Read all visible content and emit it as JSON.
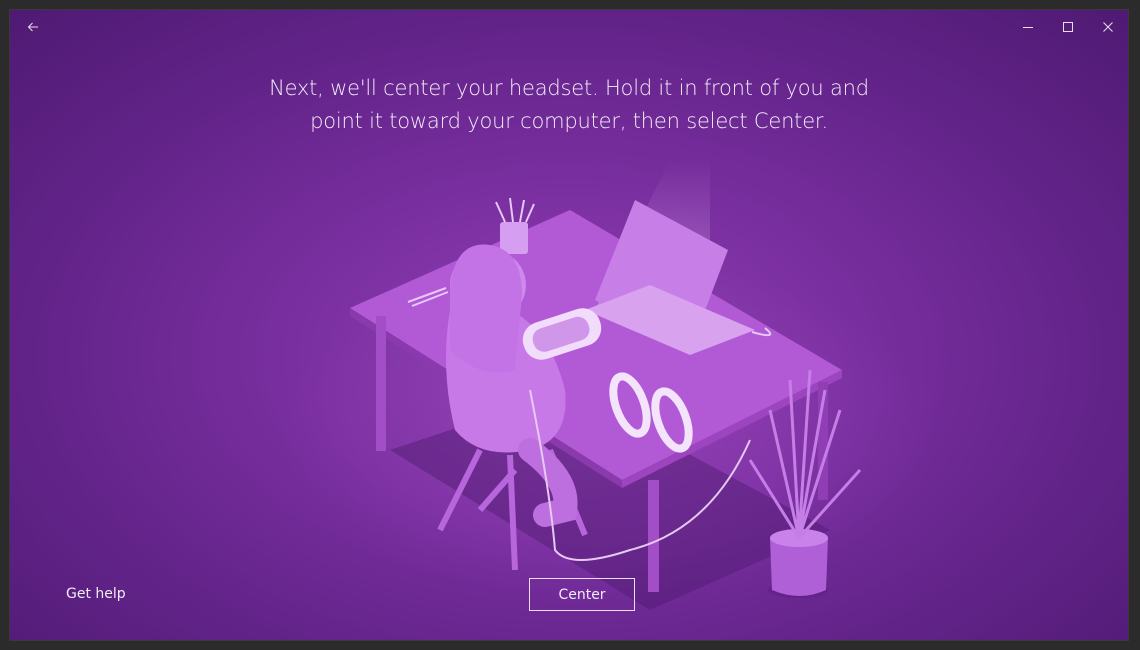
{
  "titlebar": {
    "back_icon": "arrow-left-icon",
    "minimize_icon": "minimize-icon",
    "maximize_icon": "maximize-icon",
    "close_icon": "close-icon"
  },
  "instruction": {
    "line1": "Next, we'll center your headset. Hold it in front of you and",
    "line2": "point it toward your computer, then select Center."
  },
  "footer": {
    "help_label": "Get help",
    "center_label": "Center"
  },
  "colors": {
    "background": "#7a2fa0",
    "text": "#f3ecf8",
    "accent": "#b25ad6"
  }
}
